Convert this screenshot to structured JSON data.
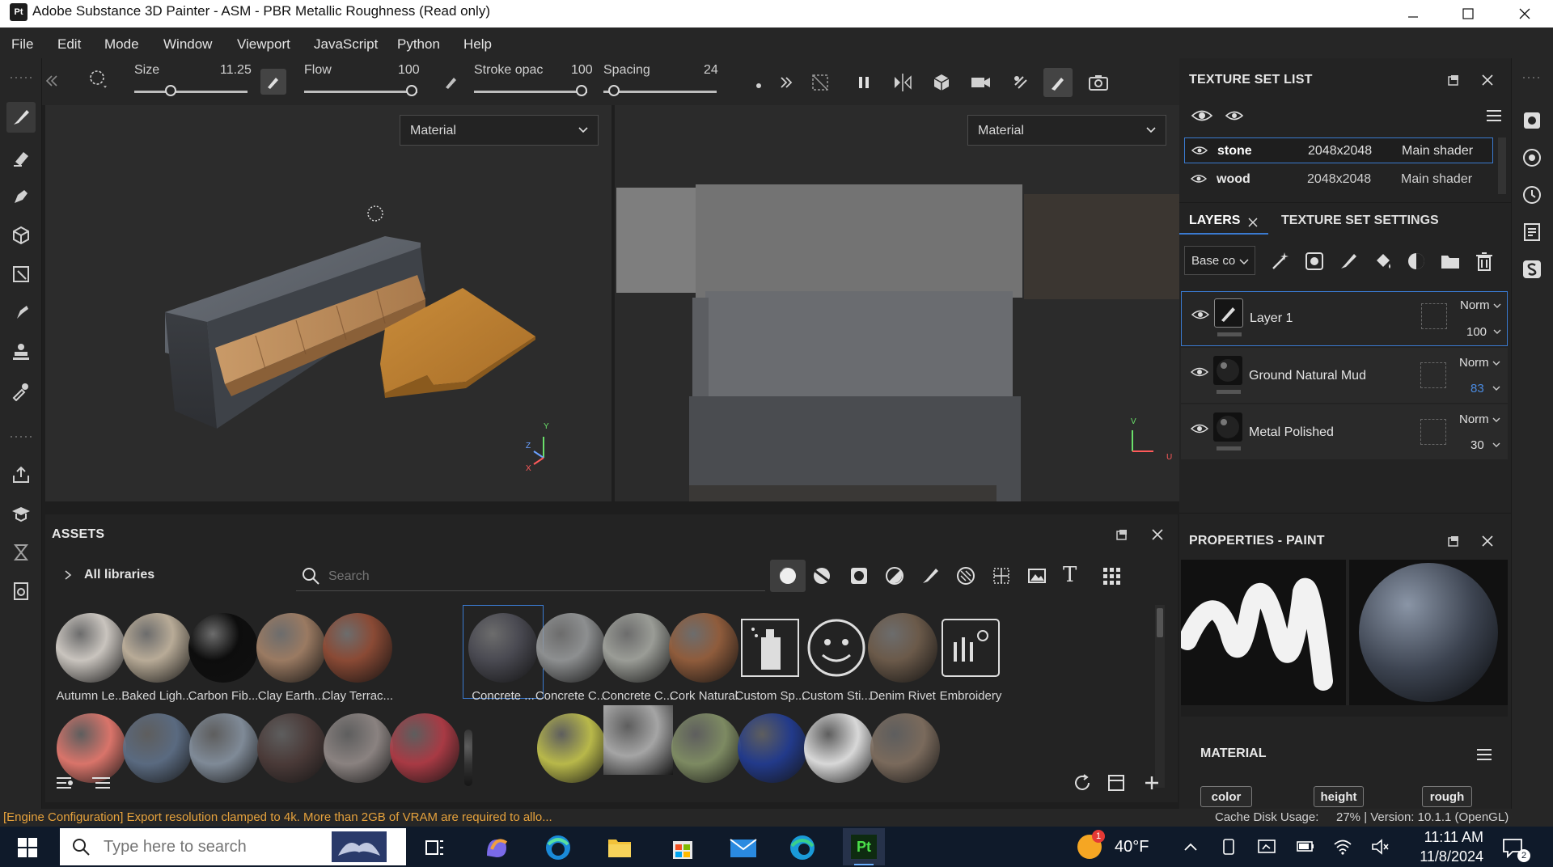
{
  "window": {
    "title": "Adobe Substance 3D Painter - ASM - PBR Metallic Roughness (Read only)",
    "app_icon_text": "Pt"
  },
  "menu": [
    "File",
    "Edit",
    "Mode",
    "Window",
    "Viewport",
    "JavaScript",
    "Python",
    "Help"
  ],
  "toolbar": {
    "size_label": "Size",
    "size_value": "11.25",
    "size_level": 0.3,
    "flow_label": "Flow",
    "flow_value": "100",
    "flow_level": 1.0,
    "stroke_label": "Stroke opac",
    "stroke_value": "100",
    "stroke_level": 1.0,
    "spacing_label": "Spacing",
    "spacing_value": "24",
    "spacing_level": 0.05
  },
  "viewports": {
    "left_dropdown": "Material",
    "right_dropdown": "Material"
  },
  "axes3d": {
    "y": "Y",
    "z": "Z",
    "x": "X"
  },
  "axes2d": {
    "v": "V",
    "u": "U"
  },
  "texture_set_list": {
    "title": "TEXTURE SET LIST",
    "rows": [
      {
        "name": "stone",
        "resolution": "2048x2048",
        "shader": "Main shader"
      },
      {
        "name": "wood",
        "resolution": "2048x2048",
        "shader": "Main shader"
      }
    ]
  },
  "layers": {
    "tab_layers": "LAYERS",
    "tab_settings": "TEXTURE SET SETTINGS",
    "channel_dropdown": "Base co",
    "items": [
      {
        "name": "Layer 1",
        "blend": "Norm",
        "opacity": "100"
      },
      {
        "name": "Ground Natural Mud",
        "blend": "Norm",
        "opacity": "83"
      },
      {
        "name": "Metal Polished",
        "blend": "Norm",
        "opacity": "30"
      }
    ]
  },
  "properties": {
    "title": "PROPERTIES - PAINT",
    "material_label": "MATERIAL",
    "chips": [
      "color",
      "height",
      "rough"
    ]
  },
  "assets": {
    "title": "ASSETS",
    "library": "All libraries",
    "search_placeholder": "Search",
    "row1": [
      {
        "label": "Autumn Le...",
        "color": "#c9c4be"
      },
      {
        "label": "Baked Ligh...",
        "color": "#b8ab97"
      },
      {
        "label": "Carbon Fib...",
        "color": "#0d0d0d"
      },
      {
        "label": "Clay Earth...",
        "color": "#9a7a62"
      },
      {
        "label": "Clay Terrac...",
        "color": "#8a4a35"
      },
      {
        "label": "Concrete ...",
        "color": "#4a4a52"
      },
      {
        "label": "Concrete C...",
        "color": "#8d8f90"
      },
      {
        "label": "Concrete C...",
        "color": "#9a9c96"
      },
      {
        "label": "Cork Natural",
        "color": "#8f5c3c"
      },
      {
        "label": "Custom Sp...",
        "color": "#2c2c2c"
      },
      {
        "label": "Custom Sti...",
        "color": "#2c2c2c"
      },
      {
        "label": "Denim Rivet",
        "color": "#6b5a4a"
      },
      {
        "label": "Embroidery",
        "color": "#2c2c2c"
      }
    ],
    "row2_colors": [
      "#d9746a",
      "#5a6a80",
      "#7f8a97",
      "#4a3a38",
      "#8a8280",
      "#a83a44",
      "#333333",
      "#b8b84a",
      "#a5a5a5",
      "#7d8a62",
      "#223a8a",
      "#d8d8d8",
      "#7a6a5c"
    ]
  },
  "status": {
    "message": "[Engine Configuration] Export resolution clamped to 4k. More than 2GB of VRAM are required to allo...",
    "cache_label": "Cache Disk Usage:",
    "cache_info": "27% | Version: 10.1.1 (OpenGL)"
  },
  "taskbar": {
    "search_placeholder": "Type here to search",
    "temperature": "40°F",
    "time": "11:11 AM",
    "date": "11/8/2024",
    "notification_count": "2",
    "weather_badge": "1",
    "pinned_app_text": "Pt"
  }
}
